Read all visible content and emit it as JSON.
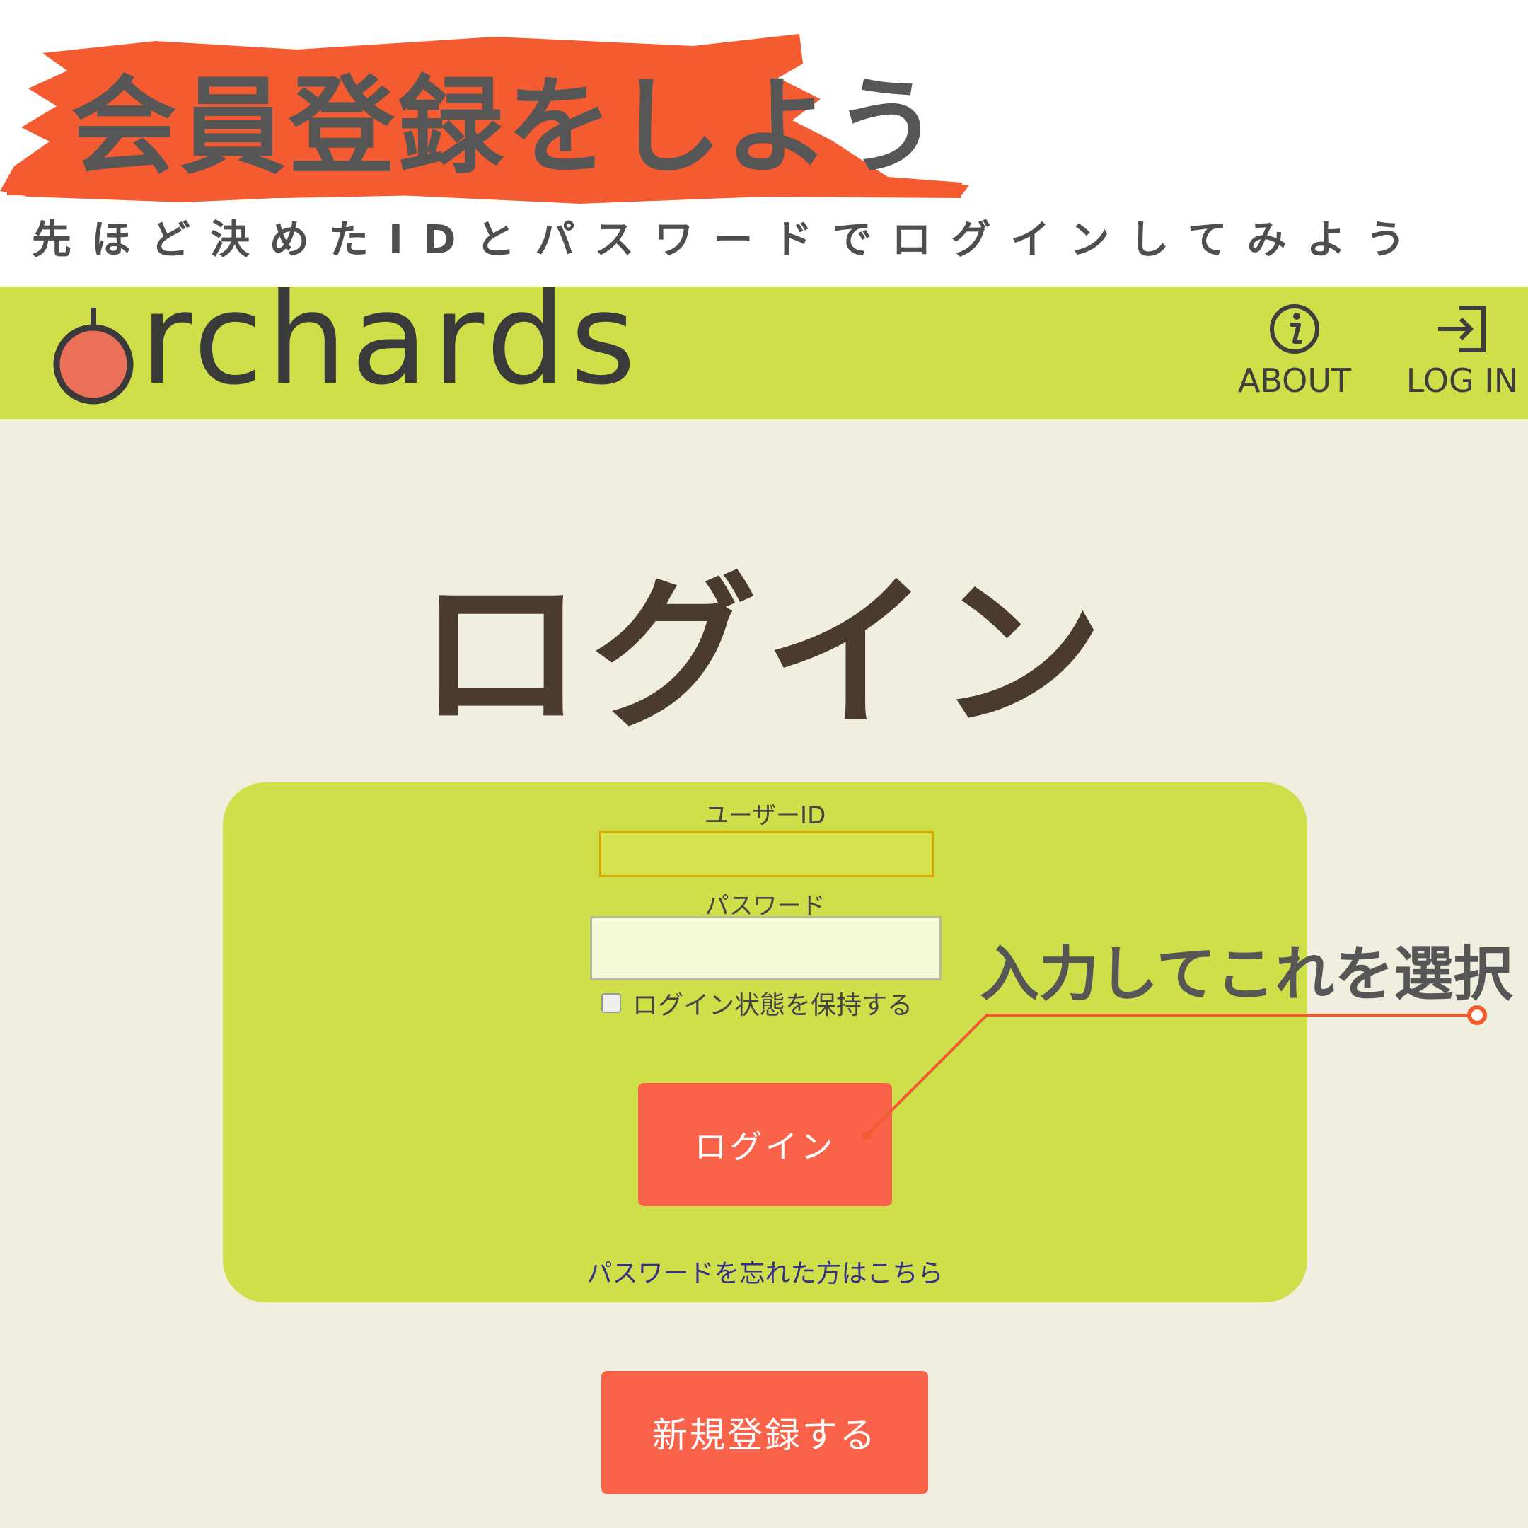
{
  "banner": {
    "headline": "会員登録をしよう",
    "subline": "先ほど決めたIDとパスワードでログインしてみよう",
    "brush_color": "#f45b31"
  },
  "header": {
    "logo_text": "rchards",
    "logo_mark_color": "#ec6f59",
    "nav": [
      {
        "label": "ABOUT",
        "icon": "info-circle-icon"
      },
      {
        "label": "LOG IN",
        "icon": "login-arrow-icon"
      }
    ],
    "background": "#cfdf49"
  },
  "main": {
    "title": "ログイン",
    "form": {
      "user_id_label": "ユーザーID",
      "user_id_value": "",
      "password_label": "パスワード",
      "password_value": "",
      "remember_label": "ログイン状態を保持する",
      "remember_checked": false,
      "login_button": "ログイン",
      "forgot_link": "パスワードを忘れた方はこちら"
    },
    "register_button": "新規登録する",
    "button_color": "#fa624a"
  },
  "annotation": {
    "text": "入力してこれを選択",
    "line_color": "#f05a2c"
  }
}
